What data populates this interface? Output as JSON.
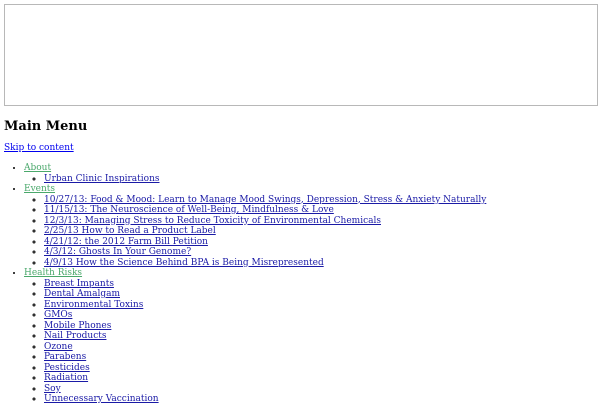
{
  "page": {
    "main_menu_title": "Main Menu",
    "skip_link": "Skip to content"
  },
  "menu": {
    "about": {
      "label": "About",
      "items": [
        "Urban Clinic Inspirations"
      ]
    },
    "events": {
      "label": "Events",
      "items": [
        "10/27/13: Food & Mood: Learn to Manage Mood Swings, Depression, Stress & Anxiety Naturally",
        "11/15/13: The Neuroscience of Well-Being, Mindfulness & Love",
        "12/3/13: Managing Stress to Reduce Toxicity of Environmental Chemicals",
        "2/25/13 How to Read a Product Label",
        "4/21/12: the 2012 Farm Bill Petition",
        "4/3/12: Ghosts In Your Genome?",
        "4/9/13 How the Science Behind BPA is Being Misrepresented"
      ]
    },
    "health_risks": {
      "label": "Health Risks",
      "items": [
        "Breast Impants",
        "Dental Amalgam",
        "Environmental Toxins",
        "GMOs",
        "Mobile Phones",
        "Nail Products",
        "Ozone",
        "Parabens",
        "Pesticides",
        "Radiation",
        "Soy",
        "Unnecessary Vaccination"
      ]
    }
  },
  "colors": {
    "top_link": "#4aa86b",
    "sub_link": "#1a1aa6",
    "skip_link": "#0000ee"
  }
}
